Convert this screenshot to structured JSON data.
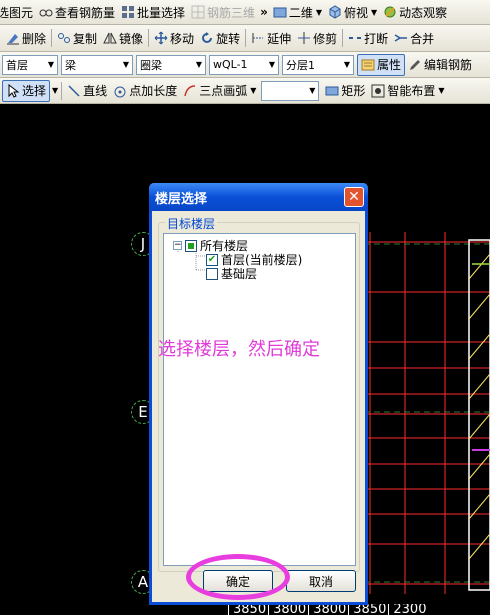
{
  "toolbar1": {
    "items": [
      "选图元",
      "查看钢筋量",
      "批量选择",
      "钢筋三维",
      "二维",
      "俯视",
      "动态观察"
    ],
    "overflow": "»"
  },
  "toolbar2": {
    "items": [
      "删除",
      "复制",
      "镜像",
      "移动",
      "旋转",
      "延伸",
      "修剪",
      "打断",
      "合并"
    ]
  },
  "toolbar3": {
    "floor": "首层",
    "type": "梁",
    "subtype": "圈梁",
    "component": "wQL-1",
    "layer": "分层1",
    "props": "属性",
    "edit_rebar": "编辑钢筋"
  },
  "toolbar4": {
    "select": "选择",
    "line": "直线",
    "point_length": "点加长度",
    "arc": "三点画弧",
    "rect": "矩形",
    "smart": "智能布置"
  },
  "axes": [
    "J",
    "E",
    "A"
  ],
  "dimensions": [
    "3850",
    "3800",
    "3800",
    "3850",
    "2300"
  ],
  "dialog": {
    "title": "楼层选择",
    "close": "✕",
    "group_label": "目标楼层",
    "tree": {
      "root": "所有楼层",
      "expander": "−",
      "children": [
        {
          "label": "首层(当前楼层)",
          "checked": true
        },
        {
          "label": "基础层",
          "checked": false
        }
      ]
    },
    "ok": "确定",
    "cancel": "取消"
  },
  "annotation": "选择楼层，然后确定",
  "colors": {
    "annotation": "#e03bd8",
    "grid_red": "#ff2a2a",
    "dialog_blue": "#0a4dd6"
  }
}
